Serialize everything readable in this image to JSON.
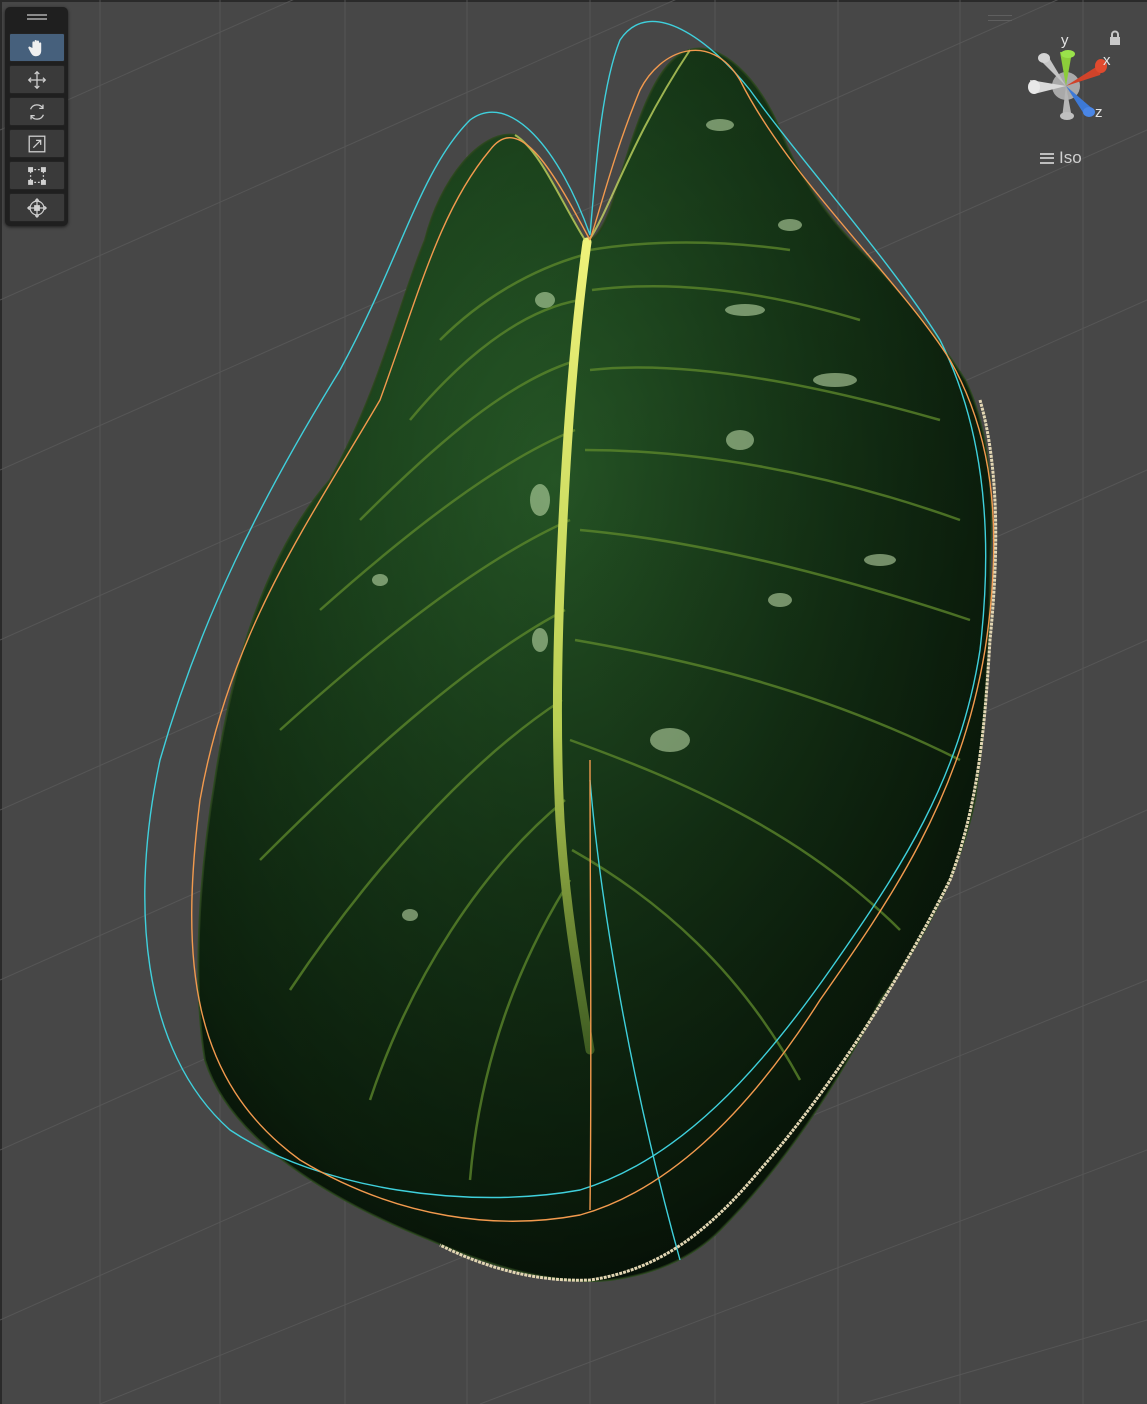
{
  "view": {
    "projection_label": "Iso"
  },
  "gizmo": {
    "axes": [
      {
        "label": "y",
        "color": "#8ccd3a"
      },
      {
        "label": "x",
        "color": "#d0432a"
      },
      {
        "label": "z",
        "color": "#3d79d6"
      }
    ]
  },
  "toolbar": {
    "tools": [
      {
        "icon": "hand-icon",
        "active": true
      },
      {
        "icon": "move-icon",
        "active": false
      },
      {
        "icon": "rotate-icon",
        "active": false
      },
      {
        "icon": "scale-icon",
        "active": false
      },
      {
        "icon": "rect-transform-icon",
        "active": false
      },
      {
        "icon": "transform-icon",
        "active": false
      }
    ]
  },
  "colors": {
    "background": "#474747",
    "leaf_dark": "#0d200e",
    "leaf_mid": "#1f4a20",
    "midrib": "#d7e86a",
    "outline_cyan": "#3fd0dc",
    "outline_orange": "#f29a4e"
  }
}
